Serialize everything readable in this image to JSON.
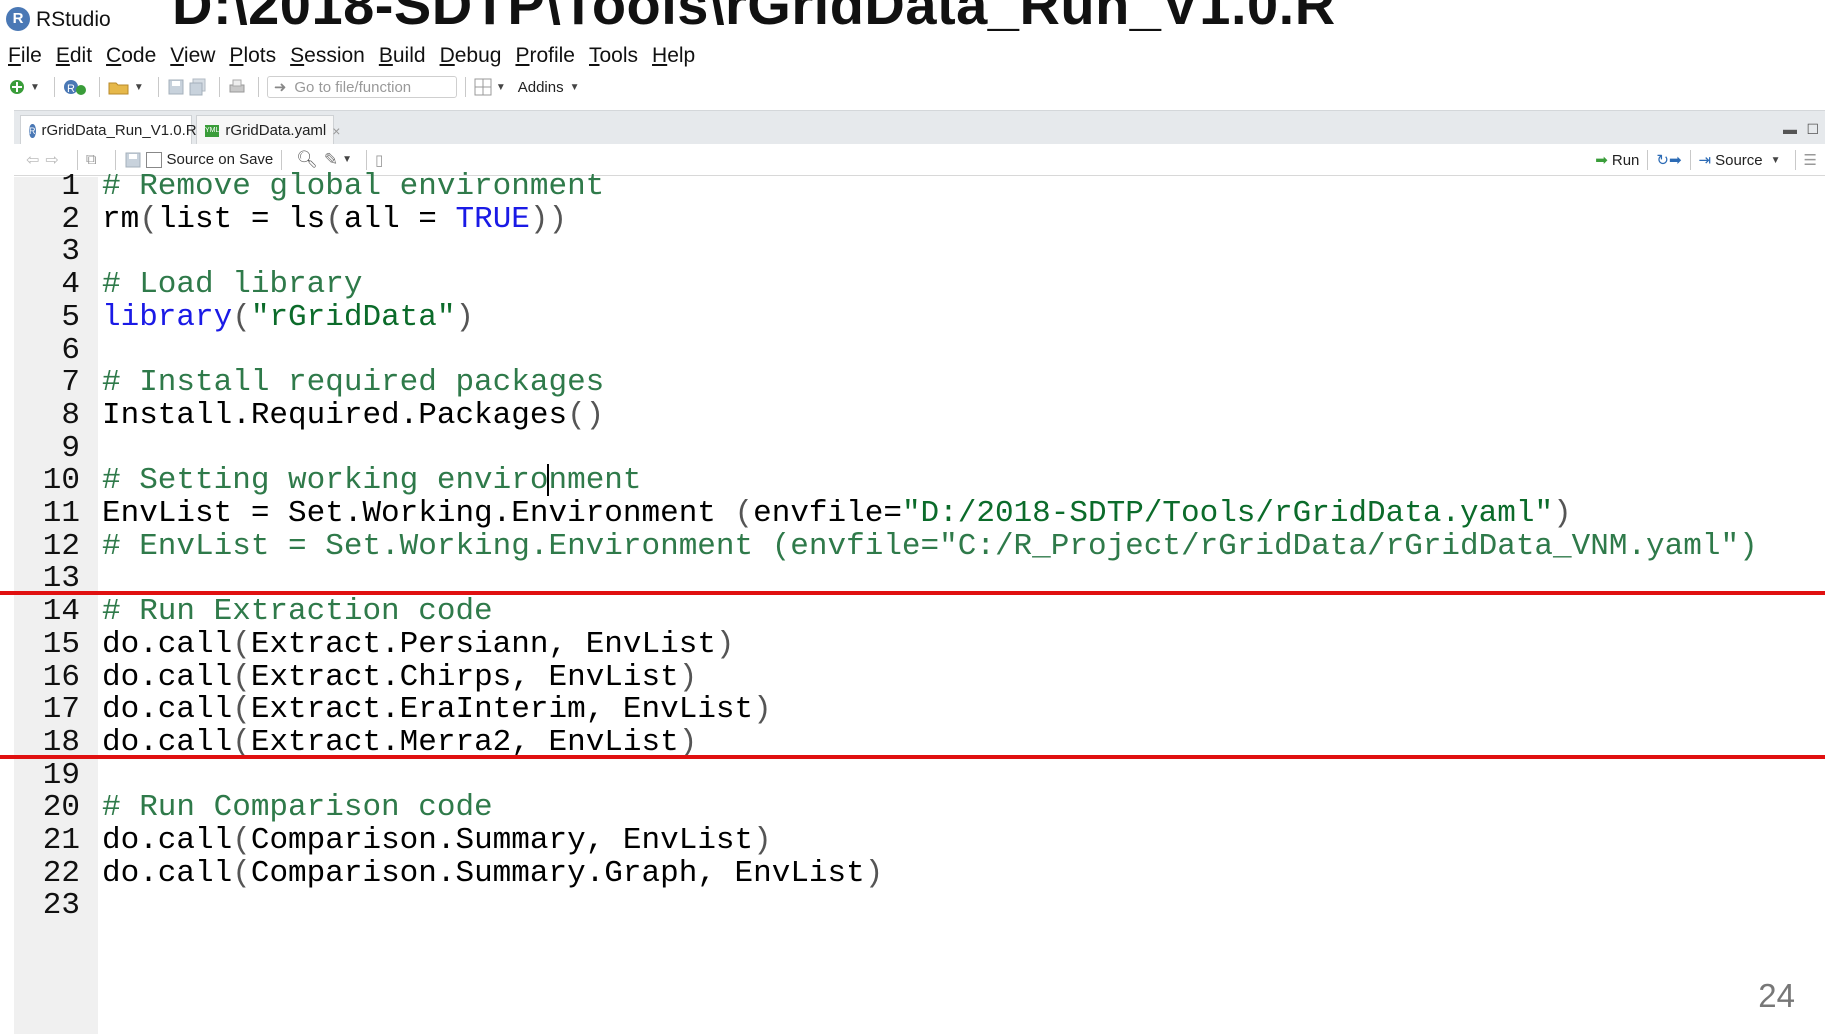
{
  "titlebar": {
    "app_name": "RStudio",
    "logo_letter": "R",
    "file_title": "D:\\2018-SDTP\\Tools\\rGridData_Run_V1.0.R"
  },
  "menu": [
    {
      "underline": "F",
      "rest": "ile"
    },
    {
      "underline": "E",
      "rest": "dit"
    },
    {
      "underline": "C",
      "rest": "ode"
    },
    {
      "underline": "V",
      "rest": "iew"
    },
    {
      "underline": "P",
      "rest": "lots"
    },
    {
      "underline": "S",
      "rest": "ession"
    },
    {
      "underline": "B",
      "rest": "uild"
    },
    {
      "underline": "D",
      "rest": "ebug"
    },
    {
      "underline": "P",
      "rest": "rofile"
    },
    {
      "underline": "T",
      "rest": "ools"
    },
    {
      "underline": "H",
      "rest": "elp"
    }
  ],
  "toolbar": {
    "goto_placeholder": "Go to file/function",
    "addins_label": "Addins"
  },
  "tabs": [
    {
      "label": "rGridData_Run_V1.0.R",
      "icon": "r-file-icon"
    },
    {
      "label": "rGridData.yaml",
      "icon": "yaml-file-icon"
    }
  ],
  "editor_toolbar": {
    "source_on_save": "Source on Save",
    "run_label": "Run",
    "source_label": "Source"
  },
  "code_lines": [
    [
      {
        "t": "# Remove global environment",
        "c": "cm"
      }
    ],
    [
      {
        "t": "rm",
        "c": ""
      },
      {
        "t": "(",
        "c": "pn"
      },
      {
        "t": "list = ls",
        "c": ""
      },
      {
        "t": "(",
        "c": "pn"
      },
      {
        "t": "all = ",
        "c": ""
      },
      {
        "t": "TRUE",
        "c": "kw"
      },
      {
        "t": "))",
        "c": "pn"
      }
    ],
    [],
    [
      {
        "t": "# Load library",
        "c": "cm"
      }
    ],
    [
      {
        "t": "library",
        "c": "kw"
      },
      {
        "t": "(",
        "c": "pn"
      },
      {
        "t": "\"rGridData\"",
        "c": "str"
      },
      {
        "t": ")",
        "c": "pn"
      }
    ],
    [],
    [
      {
        "t": "# Install required packages",
        "c": "cm"
      }
    ],
    [
      {
        "t": "Install.Required.Packages",
        "c": ""
      },
      {
        "t": "()",
        "c": "pn"
      }
    ],
    [],
    [
      {
        "t": "# Setting working enviro",
        "c": "cm"
      },
      {
        "t": "|",
        "c": "cursor"
      },
      {
        "t": "nment",
        "c": "cm"
      }
    ],
    [
      {
        "t": "EnvList = Set.Working.Environment ",
        "c": ""
      },
      {
        "t": "(",
        "c": "pn"
      },
      {
        "t": "envfile=",
        "c": ""
      },
      {
        "t": "\"D:/2018-SDTP/Tools/rGridData.yaml\"",
        "c": "str"
      },
      {
        "t": ")",
        "c": "pn"
      }
    ],
    [
      {
        "t": "# EnvList = Set.Working.Environment (envfile=\"C:/R_Project/rGridData/rGridData_VNM.yaml\")",
        "c": "cm"
      }
    ],
    [],
    [
      {
        "t": "# Run Extraction code",
        "c": "cm"
      }
    ],
    [
      {
        "t": "do.call",
        "c": ""
      },
      {
        "t": "(",
        "c": "pn"
      },
      {
        "t": "Extract.Persiann, EnvList",
        "c": ""
      },
      {
        "t": ")",
        "c": "pn"
      }
    ],
    [
      {
        "t": "do.call",
        "c": ""
      },
      {
        "t": "(",
        "c": "pn"
      },
      {
        "t": "Extract.Chirps, EnvList",
        "c": ""
      },
      {
        "t": ")",
        "c": "pn"
      }
    ],
    [
      {
        "t": "do.call",
        "c": ""
      },
      {
        "t": "(",
        "c": "pn"
      },
      {
        "t": "Extract.EraInterim, EnvList",
        "c": ""
      },
      {
        "t": ")",
        "c": "pn"
      }
    ],
    [
      {
        "t": "do.call",
        "c": ""
      },
      {
        "t": "(",
        "c": "pn"
      },
      {
        "t": "Extract.Merra2, EnvList",
        "c": ""
      },
      {
        "t": ")",
        "c": "pn"
      }
    ],
    [],
    [
      {
        "t": "# Run Comparison code",
        "c": "cm"
      }
    ],
    [
      {
        "t": "do.call",
        "c": ""
      },
      {
        "t": "(",
        "c": "pn"
      },
      {
        "t": "Comparison.Summary, EnvList",
        "c": ""
      },
      {
        "t": ")",
        "c": "pn"
      }
    ],
    [
      {
        "t": "do.call",
        "c": ""
      },
      {
        "t": "(",
        "c": "pn"
      },
      {
        "t": "Comparison.Summary.Graph, EnvList",
        "c": ""
      },
      {
        "t": ")",
        "c": "pn"
      }
    ],
    []
  ],
  "highlight_after_lines": [
    13,
    18
  ],
  "page_number": "24",
  "colors": {
    "comment": "#2f7a4a",
    "string": "#0b6b2a",
    "keyword": "#1a1ae6",
    "highlight": "#e01010"
  }
}
